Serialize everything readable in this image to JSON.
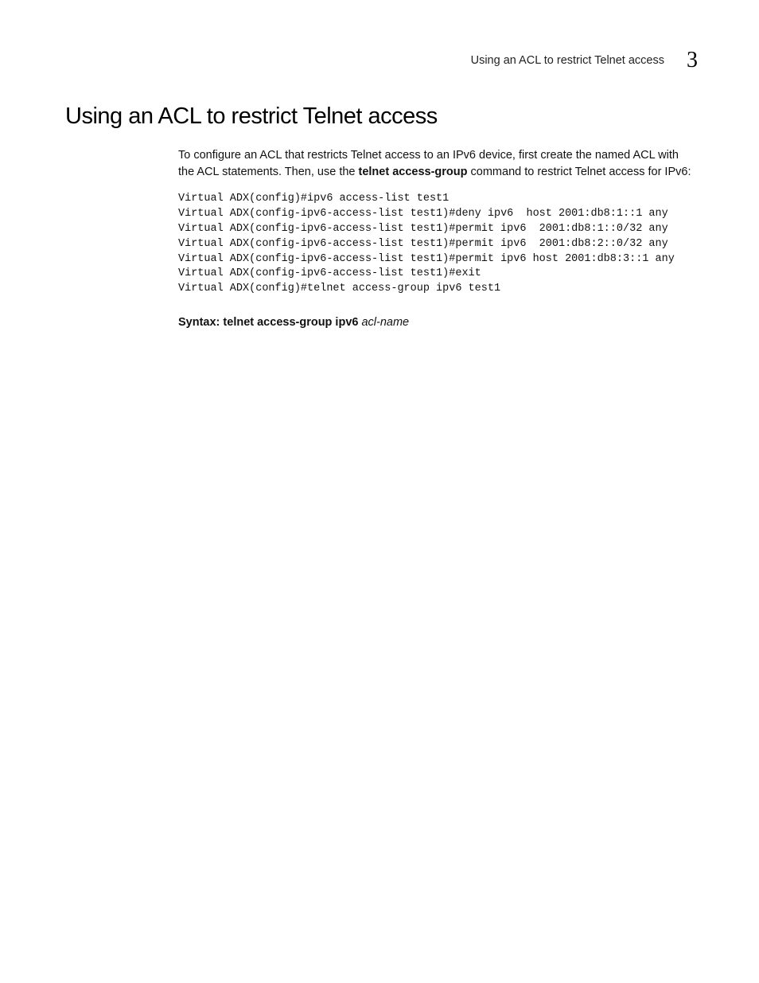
{
  "header": {
    "running_title": "Using an ACL to restrict Telnet access",
    "chapter_number": "3"
  },
  "section": {
    "heading": "Using an ACL to restrict Telnet access",
    "intro_part1": "To configure an ACL that restricts Telnet access to an IPv6 device, first create the named ACL with the ACL statements. Then, use the ",
    "intro_bold": "telnet access-group",
    "intro_part2": " command to restrict Telnet access for IPv6:"
  },
  "code": "Virtual ADX(config)#ipv6 access-list test1\nVirtual ADX(config-ipv6-access-list test1)#deny ipv6  host 2001:db8:1::1 any\nVirtual ADX(config-ipv6-access-list test1)#permit ipv6  2001:db8:1::0/32 any\nVirtual ADX(config-ipv6-access-list test1)#permit ipv6  2001:db8:2::0/32 any\nVirtual ADX(config-ipv6-access-list test1)#permit ipv6 host 2001:db8:3::1 any\nVirtual ADX(config-ipv6-access-list test1)#exit\nVirtual ADX(config)#telnet access-group ipv6 test1",
  "syntax": {
    "label": "Syntax:  ",
    "command": "telnet access-group ipv6",
    "arg": " acl-name"
  }
}
